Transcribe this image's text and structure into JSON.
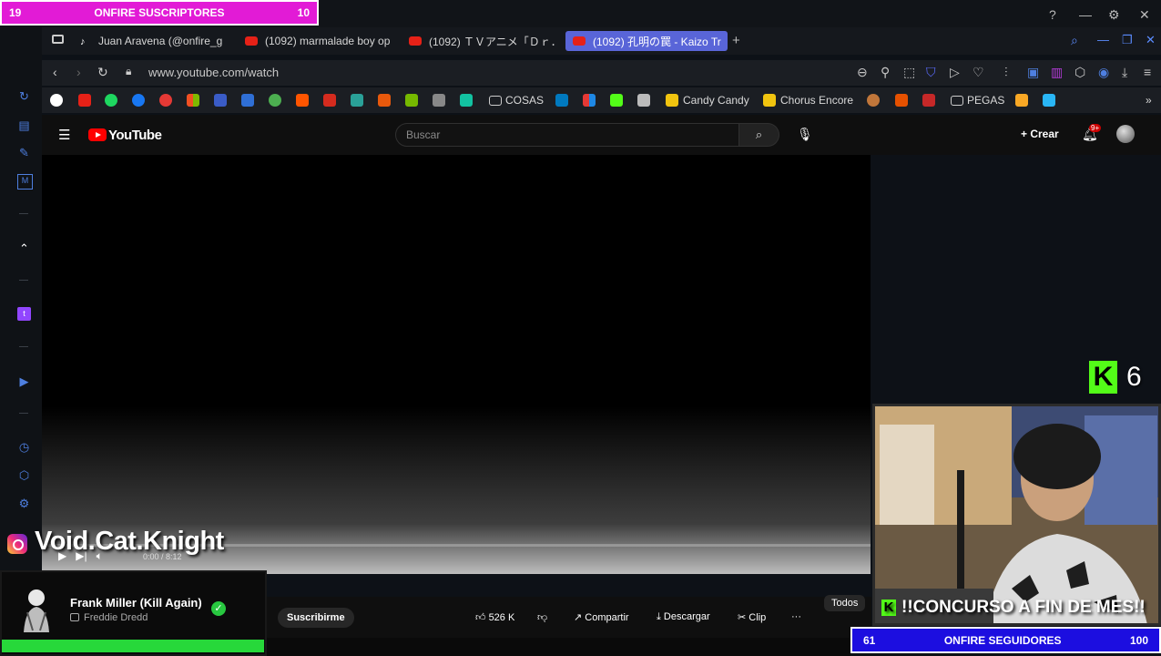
{
  "subs_goal": {
    "current": "19",
    "title": "ONFIRE SUSCRIPTORES",
    "target": "10"
  },
  "window_controls": {
    "help": "?",
    "minimize": "—",
    "settings": "⚙",
    "close": "✕"
  },
  "tabs": [
    {
      "label": "Juan Aravena (@onfire_g"
    },
    {
      "label": "(1092) marmalade boy op"
    },
    {
      "label": "(1092) ＴＶアニメ「Ｄｒ．Ｓ"
    },
    {
      "label": "(1092) 孔明の罠 - Kaizo Tr"
    }
  ],
  "address_bar": {
    "url": "www.youtube.com/watch"
  },
  "bookmarks": {
    "folder1": "COSAS",
    "candy": "Candy Candy",
    "chorus": "Chorus Encore",
    "folder2": "PEGAS"
  },
  "youtube": {
    "logo": "YouTube",
    "search_placeholder": "Buscar",
    "create": "Crear",
    "notifications": "9+",
    "video_time": "0:00 / 8:12",
    "subscribe": "Suscribirme",
    "likes": "526 K",
    "share": "Compartir",
    "download": "Descargar",
    "clip": "Clip",
    "more": "···",
    "filter_all": "Todos"
  },
  "overlay": {
    "instagram_handle": "Void.Cat.Knight",
    "kick_count": "6",
    "kick_letter": "K",
    "contest": "!!CONCURSO A FIN DE MES!!"
  },
  "now_playing": {
    "title": "Frank Miller (Kill Again)",
    "artist": "Freddie Dredd",
    "status": "✓"
  },
  "followers_goal": {
    "current": "61",
    "title": "ONFIRE SEGUIDORES",
    "target": "100"
  },
  "colors": {
    "subs_banner": "#e21bd6",
    "followers_banner": "#1c0ee0",
    "kick": "#53fc18",
    "now_playing_bar": "#27d83a",
    "active_tab": "#5965d8"
  }
}
